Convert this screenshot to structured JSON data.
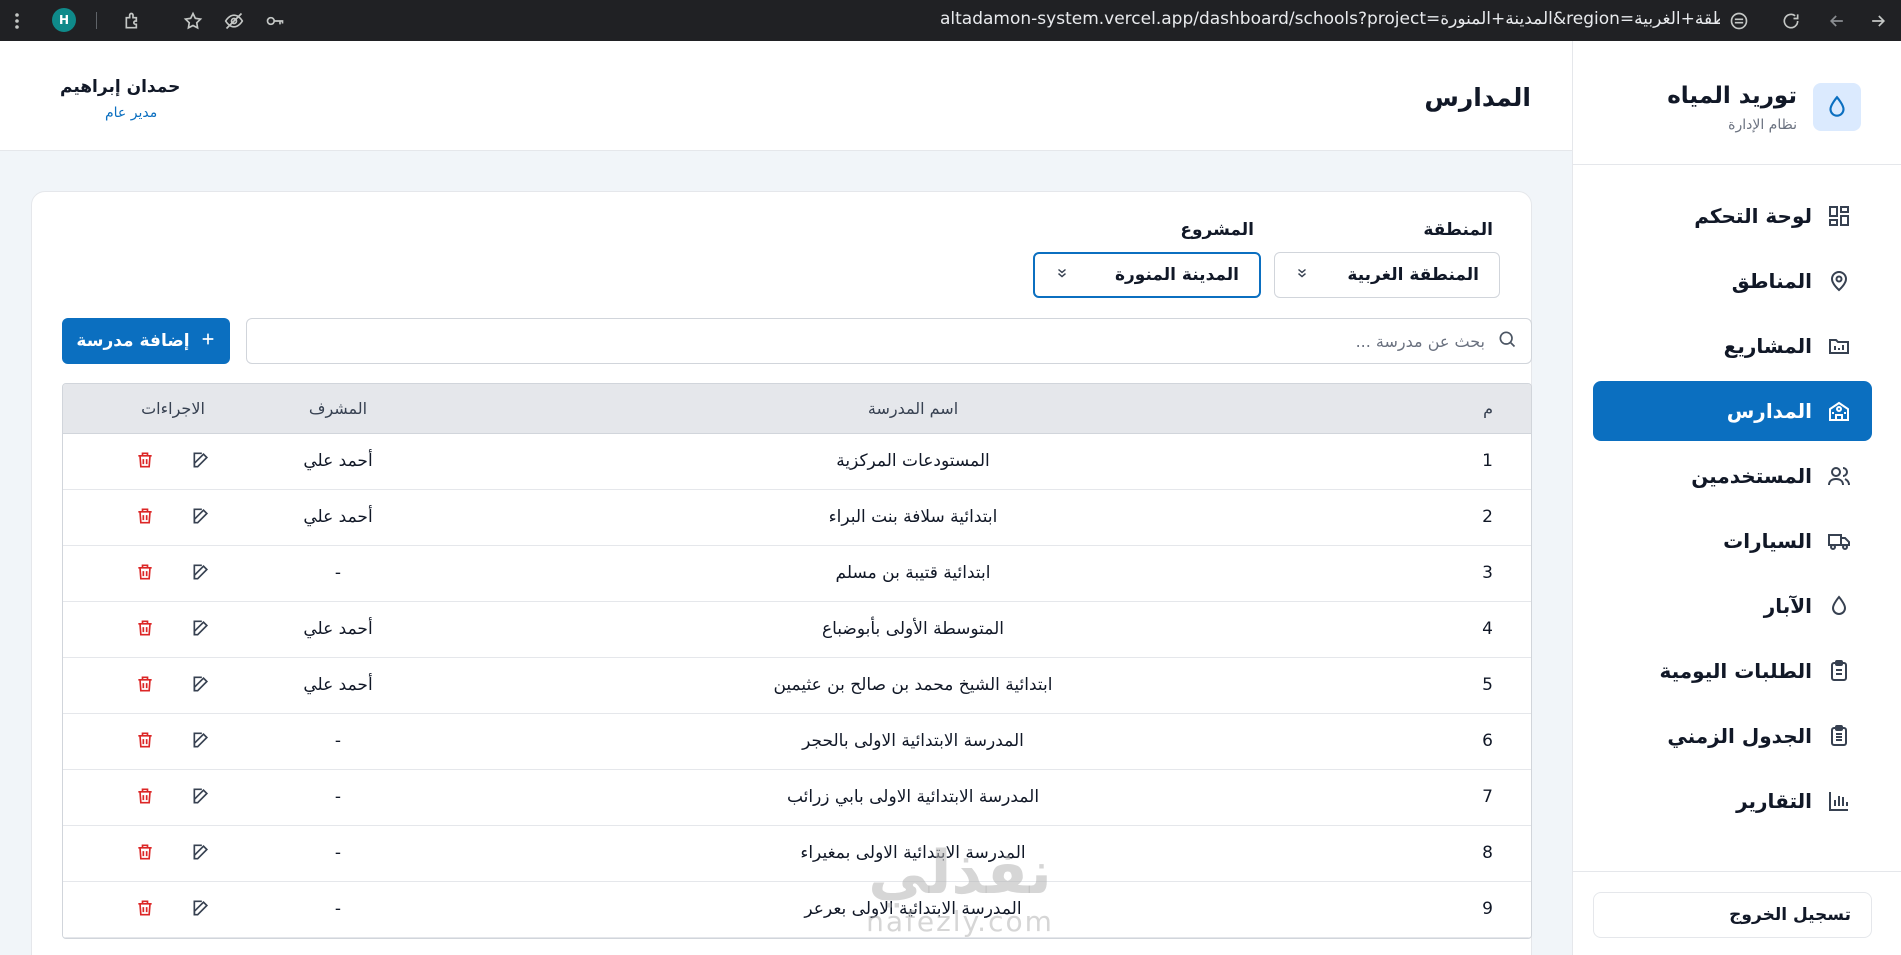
{
  "browser": {
    "profile_initial": "H",
    "url": "altadamon-system.vercel.app/dashboard/schools?project=المدينة+المنورة&region=المنطقة+الغربية"
  },
  "sidebar": {
    "brand_title": "توريد المياه",
    "brand_subtitle": "نظام الإدارة",
    "items": [
      {
        "label": "لوحة التحكم",
        "icon": "grid-icon"
      },
      {
        "label": "المناطق",
        "icon": "map-pin-icon"
      },
      {
        "label": "المشاريع",
        "icon": "folder-icon"
      },
      {
        "label": "المدارس",
        "icon": "school-icon",
        "active": true
      },
      {
        "label": "المستخدمين",
        "icon": "users-icon"
      },
      {
        "label": "السيارات",
        "icon": "truck-icon"
      },
      {
        "label": "الآبار",
        "icon": "droplet-icon"
      },
      {
        "label": "الطلبات اليومية",
        "icon": "clipboard-icon"
      },
      {
        "label": "الجدول الزمني",
        "icon": "clipboard-list-icon"
      },
      {
        "label": "التقارير",
        "icon": "bar-chart-icon"
      }
    ],
    "logout_label": "تسجيل الخروج"
  },
  "header": {
    "title": "المدارس",
    "user_name": "حمدان إبراهيم",
    "user_role": "مدير عام"
  },
  "filters": {
    "region_label": "المنطقة",
    "region_value": "المنطقة الغربية",
    "project_label": "المشروع",
    "project_value": "المدينة المنورة"
  },
  "search": {
    "placeholder": "بحث عن مدرسة ...",
    "value": ""
  },
  "add_button_label": "إضافة مدرسة",
  "table": {
    "headers": {
      "num": "م",
      "name": "اسم المدرسة",
      "supervisor": "المشرف",
      "actions": "الاجراءات"
    },
    "rows": [
      {
        "num": "1",
        "name": "المستودعات المركزية",
        "supervisor": "أحمد علي"
      },
      {
        "num": "2",
        "name": "ابتدائية سلافة بنت البراء",
        "supervisor": "أحمد علي"
      },
      {
        "num": "3",
        "name": "ابتدائية قتيبة بن مسلم",
        "supervisor": "-"
      },
      {
        "num": "4",
        "name": "المتوسطة الأولى بأبوضباع",
        "supervisor": "أحمد علي"
      },
      {
        "num": "5",
        "name": "ابتدائية الشيخ محمد بن صالح بن عثيمين",
        "supervisor": "أحمد علي"
      },
      {
        "num": "6",
        "name": "المدرسة الابتدائية الاولى بالحجر",
        "supervisor": "-"
      },
      {
        "num": "7",
        "name": "المدرسة الابتدائية الاولى بابي زرائب",
        "supervisor": "-"
      },
      {
        "num": "8",
        "name": "المدرسة الابتدائية الاولى بمغيراء",
        "supervisor": "-"
      },
      {
        "num": "9",
        "name": "المدرسة الابتدائية الاولى بعرعر",
        "supervisor": "-"
      }
    ]
  },
  "watermark": {
    "arabic": "نفذلي",
    "latin": "nafezly.com"
  },
  "colors": {
    "primary": "#0b6fc0",
    "danger": "#dc2626",
    "sidebar_active": "#0b6fc0"
  }
}
